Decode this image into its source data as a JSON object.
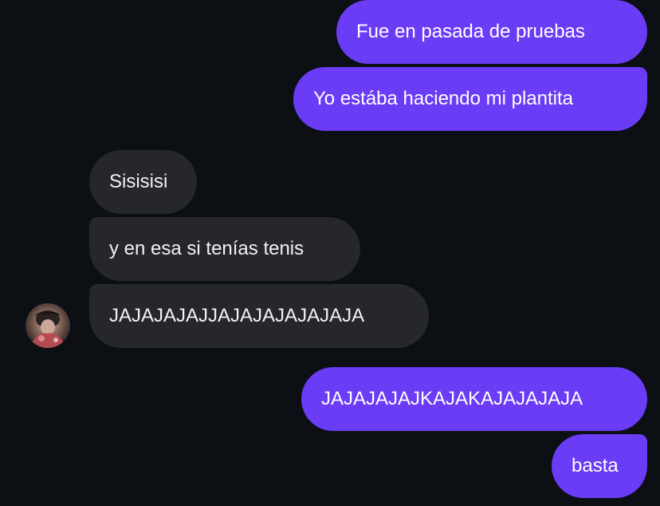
{
  "messages": [
    {
      "direction": "outgoing",
      "text": "Fue en pasada de pruebas"
    },
    {
      "direction": "outgoing",
      "text": "Yo estába haciendo mi plantita"
    },
    {
      "direction": "incoming",
      "text": "Sisisisi"
    },
    {
      "direction": "incoming",
      "text": "y en esa si tenías tenis"
    },
    {
      "direction": "incoming",
      "text": "JAJAJAJAJJAJAJAJAJAJAJA"
    },
    {
      "direction": "outgoing",
      "text": "JAJAJAJAJKAJAKAJAJAJAJA"
    },
    {
      "direction": "outgoing",
      "text": "basta"
    }
  ],
  "colors": {
    "background": "#0c0f14",
    "outgoing_bubble": "#6a3cf5",
    "incoming_bubble": "#25272c",
    "text": "#ffffff"
  },
  "contact": {
    "avatar": "contact-avatar-photo"
  }
}
